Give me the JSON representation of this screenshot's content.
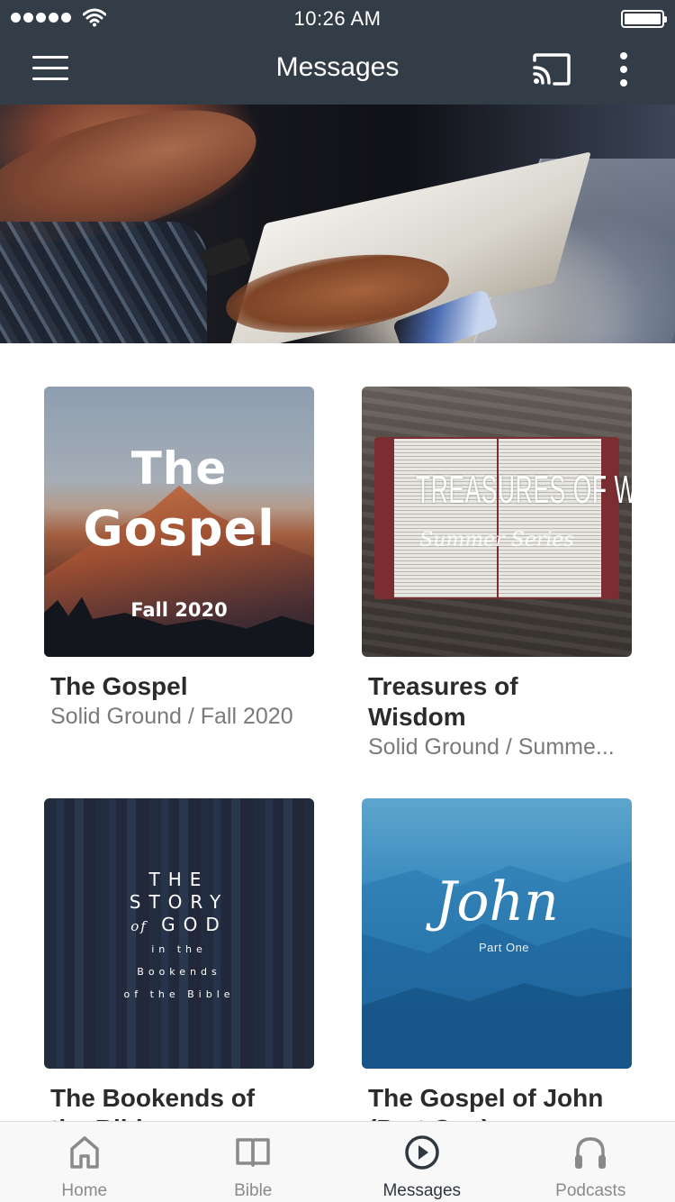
{
  "status_bar": {
    "time": "10:26 AM",
    "signal_bars": 5,
    "wifi_icon": "wifi-icon",
    "battery_level": 1.0
  },
  "nav": {
    "title": "Messages",
    "menu_icon": "hamburger-menu-icon",
    "cast_icon": "cast-icon",
    "more_icon": "more-vertical-icon"
  },
  "hero": {
    "description": "Person reading an open Bible at a lectern"
  },
  "series": [
    {
      "title": "The Gospel",
      "subtitle": "Solid Ground / Fall 2020",
      "art": {
        "line1": "The",
        "line2": "Gospel",
        "line3": "Fall 2020"
      }
    },
    {
      "title": "Treasures of Wisdom",
      "subtitle": "Solid Ground / Summe...",
      "art": {
        "line1": "TREASURES OF WISDOM",
        "line2": "Summer Series"
      }
    },
    {
      "title": "The Bookends of the Bible",
      "subtitle": "",
      "art": {
        "line1": "THE",
        "line2": "STORY",
        "line3_of": "of",
        "line3": "GOD",
        "line4": "in the",
        "line5": "Bookends",
        "line6": "of the Bible"
      }
    },
    {
      "title": "The Gospel of John (Part One)",
      "subtitle": "",
      "art": {
        "line1": "John",
        "line2": "Part One"
      }
    }
  ],
  "tab_bar": {
    "active": "Messages",
    "accent_color": "#2f3740",
    "inactive_color": "#8a8a8a",
    "tabs": [
      {
        "label": "Home",
        "icon": "home-icon"
      },
      {
        "label": "Bible",
        "icon": "book-icon"
      },
      {
        "label": "Messages",
        "icon": "play-circle-icon"
      },
      {
        "label": "Podcasts",
        "icon": "headphones-icon"
      }
    ]
  },
  "colors": {
    "header_bg": "#333d47",
    "title_text": "#2b2b2b",
    "subtitle_text": "#7a7a7a"
  }
}
